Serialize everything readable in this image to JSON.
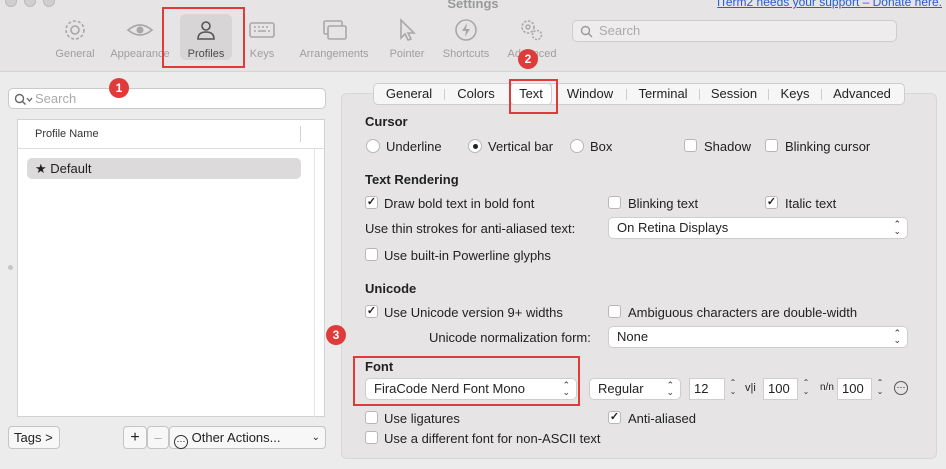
{
  "window": {
    "title": "Settings",
    "donate_text": "iTerm2 needs your support – Donate here."
  },
  "toolbar": {
    "items": [
      {
        "label": "General",
        "icon": "gear-icon"
      },
      {
        "label": "Appearance",
        "icon": "eye-icon"
      },
      {
        "label": "Profiles",
        "icon": "person-icon"
      },
      {
        "label": "Keys",
        "icon": "keyboard-icon"
      },
      {
        "label": "Arrangements",
        "icon": "windows-icon"
      },
      {
        "label": "Pointer",
        "icon": "pointer-icon"
      },
      {
        "label": "Shortcuts",
        "icon": "lightning-icon"
      },
      {
        "label": "Advanced",
        "icon": "gears-icon"
      }
    ],
    "search_placeholder": "Search"
  },
  "profiles_pane": {
    "search_placeholder": "Search",
    "column_header": "Profile Name",
    "profiles": [
      {
        "star": "★",
        "name": "Default"
      }
    ],
    "tags_button": "Tags >",
    "add_button": "+",
    "remove_button": "–",
    "other_actions_icon": "⋯",
    "other_actions": "Other Actions..."
  },
  "tabs": [
    "General",
    "Colors",
    "Text",
    "Window",
    "Terminal",
    "Session",
    "Keys",
    "Advanced"
  ],
  "cursor": {
    "heading": "Cursor",
    "options": [
      "Underline",
      "Vertical bar",
      "Box"
    ],
    "selected": "Vertical bar",
    "shadow": "Shadow",
    "blinking_cursor": "Blinking cursor"
  },
  "text_rendering": {
    "heading": "Text Rendering",
    "bold_label": "Draw bold text in bold font",
    "bold_checked": true,
    "blinking_text": "Blinking text",
    "blinking_checked": false,
    "italic_text": "Italic text",
    "italic_checked": true,
    "thin_strokes_label": "Use thin strokes for anti-aliased text:",
    "thin_strokes_value": "On Retina Displays",
    "powerline_label": "Use built-in Powerline glyphs",
    "powerline_checked": false
  },
  "unicode": {
    "heading": "Unicode",
    "version_label": "Use Unicode version 9+ widths",
    "version_checked": true,
    "ambiguous_label": "Ambiguous characters are double-width",
    "ambiguous_checked": false,
    "normalization_label": "Unicode normalization form:",
    "normalization_value": "None"
  },
  "font": {
    "heading": "Font",
    "family": "FiraCode Nerd Font Mono",
    "style": "Regular",
    "size": "12",
    "vertical_spacing_icon": "v|i",
    "vertical_spacing": "100",
    "horizontal_spacing_icon": "n/n",
    "horizontal_spacing": "100",
    "ligatures_label": "Use ligatures",
    "ligatures_checked": false,
    "anti_aliased_label": "Anti-aliased",
    "anti_aliased_checked": true,
    "non_ascii_label": "Use a different font for non-ASCII text",
    "non_ascii_checked": false
  },
  "annotations": [
    "1",
    "2",
    "3"
  ],
  "colors": {
    "annotation": "#e03b3b",
    "link": "#2a5bd7"
  }
}
